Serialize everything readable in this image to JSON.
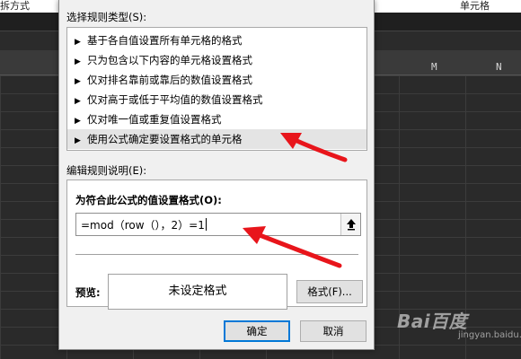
{
  "background": {
    "ribbon_left": "拆方式",
    "ribbon_right": "单元格",
    "column_labels": [
      "M",
      "N"
    ]
  },
  "dialog": {
    "rule_type_label": "选择规则类型(S):",
    "rule_types": [
      {
        "label": "基于各自值设置所有单元格的格式"
      },
      {
        "label": "只为包含以下内容的单元格设置格式"
      },
      {
        "label": "仅对排名靠前或靠后的数值设置格式"
      },
      {
        "label": "仅对高于或低于平均值的数值设置格式"
      },
      {
        "label": "仅对唯一值或重复值设置格式"
      },
      {
        "label": "使用公式确定要设置格式的单元格",
        "selected": true
      }
    ],
    "edit_desc_label": "编辑规则说明(E):",
    "formula_label": "为符合此公式的值设置格式(O):",
    "formula_value": "=mod（row（），2）=1",
    "preview_label": "预览:",
    "preview_text": "未设定格式",
    "format_button": "格式(F)...",
    "ok_button": "确定",
    "cancel_button": "取消"
  },
  "watermark": {
    "brand": "Bai百度",
    "sub": "jingyan.baidu.com"
  },
  "colors": {
    "annotation_arrow": "#e8151b",
    "focus_border": "#0078d7",
    "selected_row": "#e4e4e4"
  },
  "icons": {
    "list_bullet": "right-triangle-icon",
    "collapse": "collapse-up-arrow-icon"
  }
}
